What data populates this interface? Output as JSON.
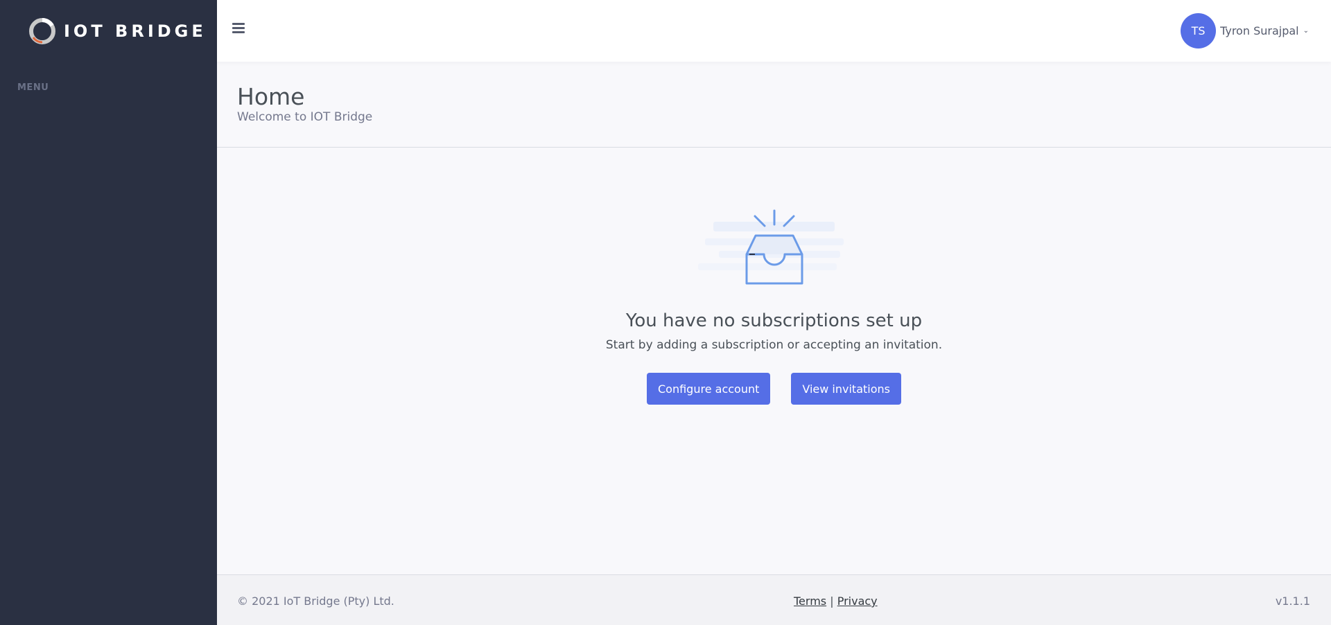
{
  "brand": {
    "name": "IOT BRIDGE"
  },
  "sidebar": {
    "menu_title": "MENU"
  },
  "user": {
    "initials": "TS",
    "name": "Tyron Surajpal"
  },
  "page": {
    "title": "Home",
    "subtitle": "Welcome to IOT Bridge"
  },
  "empty_state": {
    "title": "You have no subscriptions set up",
    "subtitle": "Start by adding a subscription or accepting an invitation.",
    "primary_button": "Configure account",
    "secondary_button": "View invitations"
  },
  "footer": {
    "copyright": "© 2021 IoT Bridge (Pty) Ltd.",
    "terms": "Terms",
    "separator": "|",
    "privacy": "Privacy",
    "version": "v1.1.1"
  },
  "colors": {
    "sidebar": "#2a3042",
    "accent": "#556ee6",
    "illustration": "#6b9be8"
  }
}
